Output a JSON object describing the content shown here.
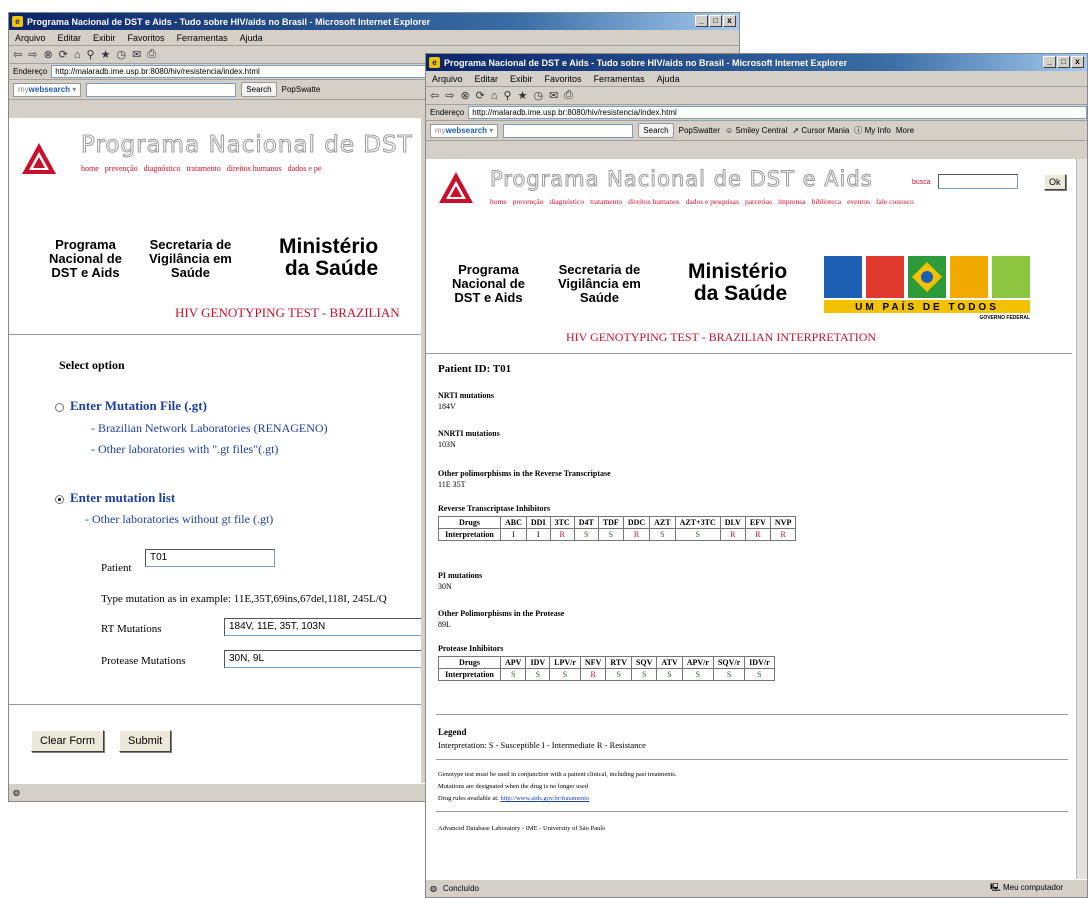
{
  "window1": {
    "title": "Programa Nacional de DST e Aids - Tudo sobre HIV/aids no Brasil - Microsoft Internet Explorer",
    "menu": [
      "Arquivo",
      "Editar",
      "Exibir",
      "Favoritos",
      "Ferramentas",
      "Ajuda"
    ],
    "address_label": "Endereço",
    "address": "http://malaradb.ime.usp.br:8080/hiv/resistencia/index.html",
    "search_brand_a": "my",
    "search_brand_b": "websearch",
    "search_label": "Search",
    "popswatter": "PopSwatte",
    "site_title": "Programa Nacional de DST",
    "nav": [
      "home",
      "prevenção",
      "diagnóstico",
      "tratamento",
      "direitos humanos",
      "dados e pe"
    ],
    "org1": "Programa\nNacional de\nDST e Aids",
    "org2": "Secretaria de\nVigilância em\nSaúde",
    "ministerio": "Ministério\nda Saúde",
    "genotype_title": "HIV GENOTYPING TEST - BRAZILIAN",
    "select_option": "Select option",
    "opt1": "Enter Mutation File (.gt)",
    "opt1_a": "- Brazilian Network Laboratories (RENAGENO)",
    "opt1_b": "- Other laboratories with \".gt files\"(.gt)",
    "opt2": "Enter mutation list",
    "opt2_a": "- Other laboratories without gt file (.gt)",
    "patient_label": "Patient",
    "patient_value": "T01",
    "example": "Type mutation as in example: 11E,35T,69ins,67del,118I, 245L/Q",
    "rt_label": "RT Mutations",
    "rt_value": "184V, 11E, 35T, 103N",
    "pr_label": "Protease Mutations",
    "pr_value": "30N, 9L",
    "clear_btn": "Clear Form",
    "submit_btn": "Submit"
  },
  "window2": {
    "title": "Programa Nacional de DST e Aids - Tudo sobre HIV/aids no Brasil - Microsoft Internet Explorer",
    "menu": [
      "Arquivo",
      "Editar",
      "Exibir",
      "Favoritos",
      "Ferramentas",
      "Ajuda"
    ],
    "address_label": "Endereço",
    "address": "http://malaradb.ime.usp.br:8080/hiv/resistencia/index.html",
    "search_brand_a": "my",
    "search_brand_b": "websearch",
    "search_label": "Search",
    "links": [
      "PopSwatter",
      "Smiley Central",
      "Cursor Mania",
      "My Info",
      "More"
    ],
    "site_title": "Programa Nacional de DST e Aids",
    "busca_label": "busca",
    "ok_label": "Ok",
    "nav": [
      "home",
      "prevenção",
      "diagnóstico",
      "tratamento",
      "direitos humanos",
      "dados e pesquisas",
      "parcerias",
      "imprensa",
      "biblioteca",
      "eventos",
      "fale conosco"
    ],
    "org1": "Programa\nNacional de\nDST e Aids",
    "org2": "Secretaria de\nVigilância em\nSaúde",
    "ministerio": "Ministério\nda Saúde",
    "brasil_tagline": "UM PAÍS DE TODOS",
    "brasil_gov": "GOVERNO FEDERAL",
    "genotype_title": "HIV GENOTYPING TEST - BRAZILIAN INTERPRETATION",
    "patient_id": "Patient ID: T01",
    "nrti_h": "NRTI mutations",
    "nrti_v": "184V",
    "nnrti_h": "NNRTI mutations",
    "nnrti_v": "103N",
    "other_rt_h": "Other polimorphisms in the Reverse Transcriptase",
    "other_rt_v": "11E 35T",
    "rti_h": "Reverse Transcriptase Inhibitors",
    "rti_table": {
      "drugs_label": "Drugs",
      "interp_label": "Interpretation",
      "drugs": [
        "ABC",
        "DDI",
        "3TC",
        "D4T",
        "TDF",
        "DDC",
        "AZT",
        "AZT+3TC",
        "DLV",
        "EFV",
        "NVP"
      ],
      "values": [
        "I",
        "I",
        "R",
        "S",
        "S",
        "R",
        "S",
        "S",
        "R",
        "R",
        "R"
      ]
    },
    "pi_h": "PI mutations",
    "pi_v": "30N",
    "other_pr_h": "Other Polimorphisms in the Protease",
    "other_pr_v": "89L",
    "pri_h": "Protease Inhibitors",
    "pri_table": {
      "drugs_label": "Drugs",
      "interp_label": "Interpretation",
      "drugs": [
        "APV",
        "IDV",
        "LPV/r",
        "NFV",
        "RTV",
        "SQV",
        "ATV",
        "APV/r",
        "SQV/r",
        "IDV/r"
      ],
      "values": [
        "S",
        "S",
        "S",
        "R",
        "S",
        "S",
        "S",
        "S",
        "S",
        "S"
      ]
    },
    "legend_h": "Legend",
    "legend_v": "Interpretation: S - Susceptible I - Intermediate R - Resistance",
    "note1": "Genotype test must be used in conjunction with a patient clinical, including past treatments.",
    "note2": "Mutations are designated when the drug is no longer used",
    "note3": "Drug rules available at:",
    "note3_link": "http://www.aids.gov.br/tratamento",
    "footer": "Advanced Database Laboratory - IME - University of São Paulo",
    "status": "Concluído",
    "status_right": "Meu computador"
  },
  "colors": {
    "brand_red": "#c8102e",
    "link_blue": "#1d3fa3",
    "titlebar": "#0a246a"
  }
}
